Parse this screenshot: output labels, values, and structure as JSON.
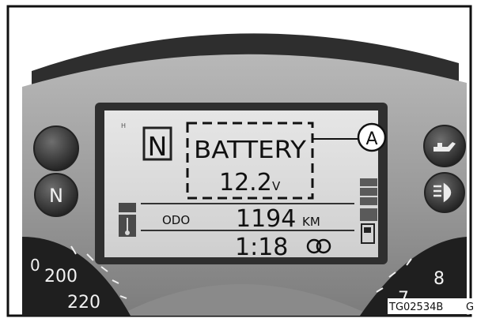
{
  "lcd": {
    "gear": "N",
    "gear_superscript": "H",
    "battery_label": "BATTERY",
    "battery_voltage": "12.2",
    "battery_unit": "V",
    "odo_label": "ODO",
    "odometer": "1194",
    "odometer_unit": "KM",
    "clock": "1:18"
  },
  "callout": {
    "letter": "A"
  },
  "buttons": {
    "neutral_label": "N"
  },
  "speedometer": {
    "tick_200": "200",
    "tick_220": "220",
    "tick_left_partial": "0"
  },
  "tachometer": {
    "tick_8": "8",
    "tick_7": "7"
  },
  "figure": {
    "code": "TG02534B",
    "trailing": "G"
  },
  "colors": {
    "lcd_background": "#dcdcdc",
    "bezel": "#3a3a3a",
    "housing": "#9a9a9a"
  }
}
